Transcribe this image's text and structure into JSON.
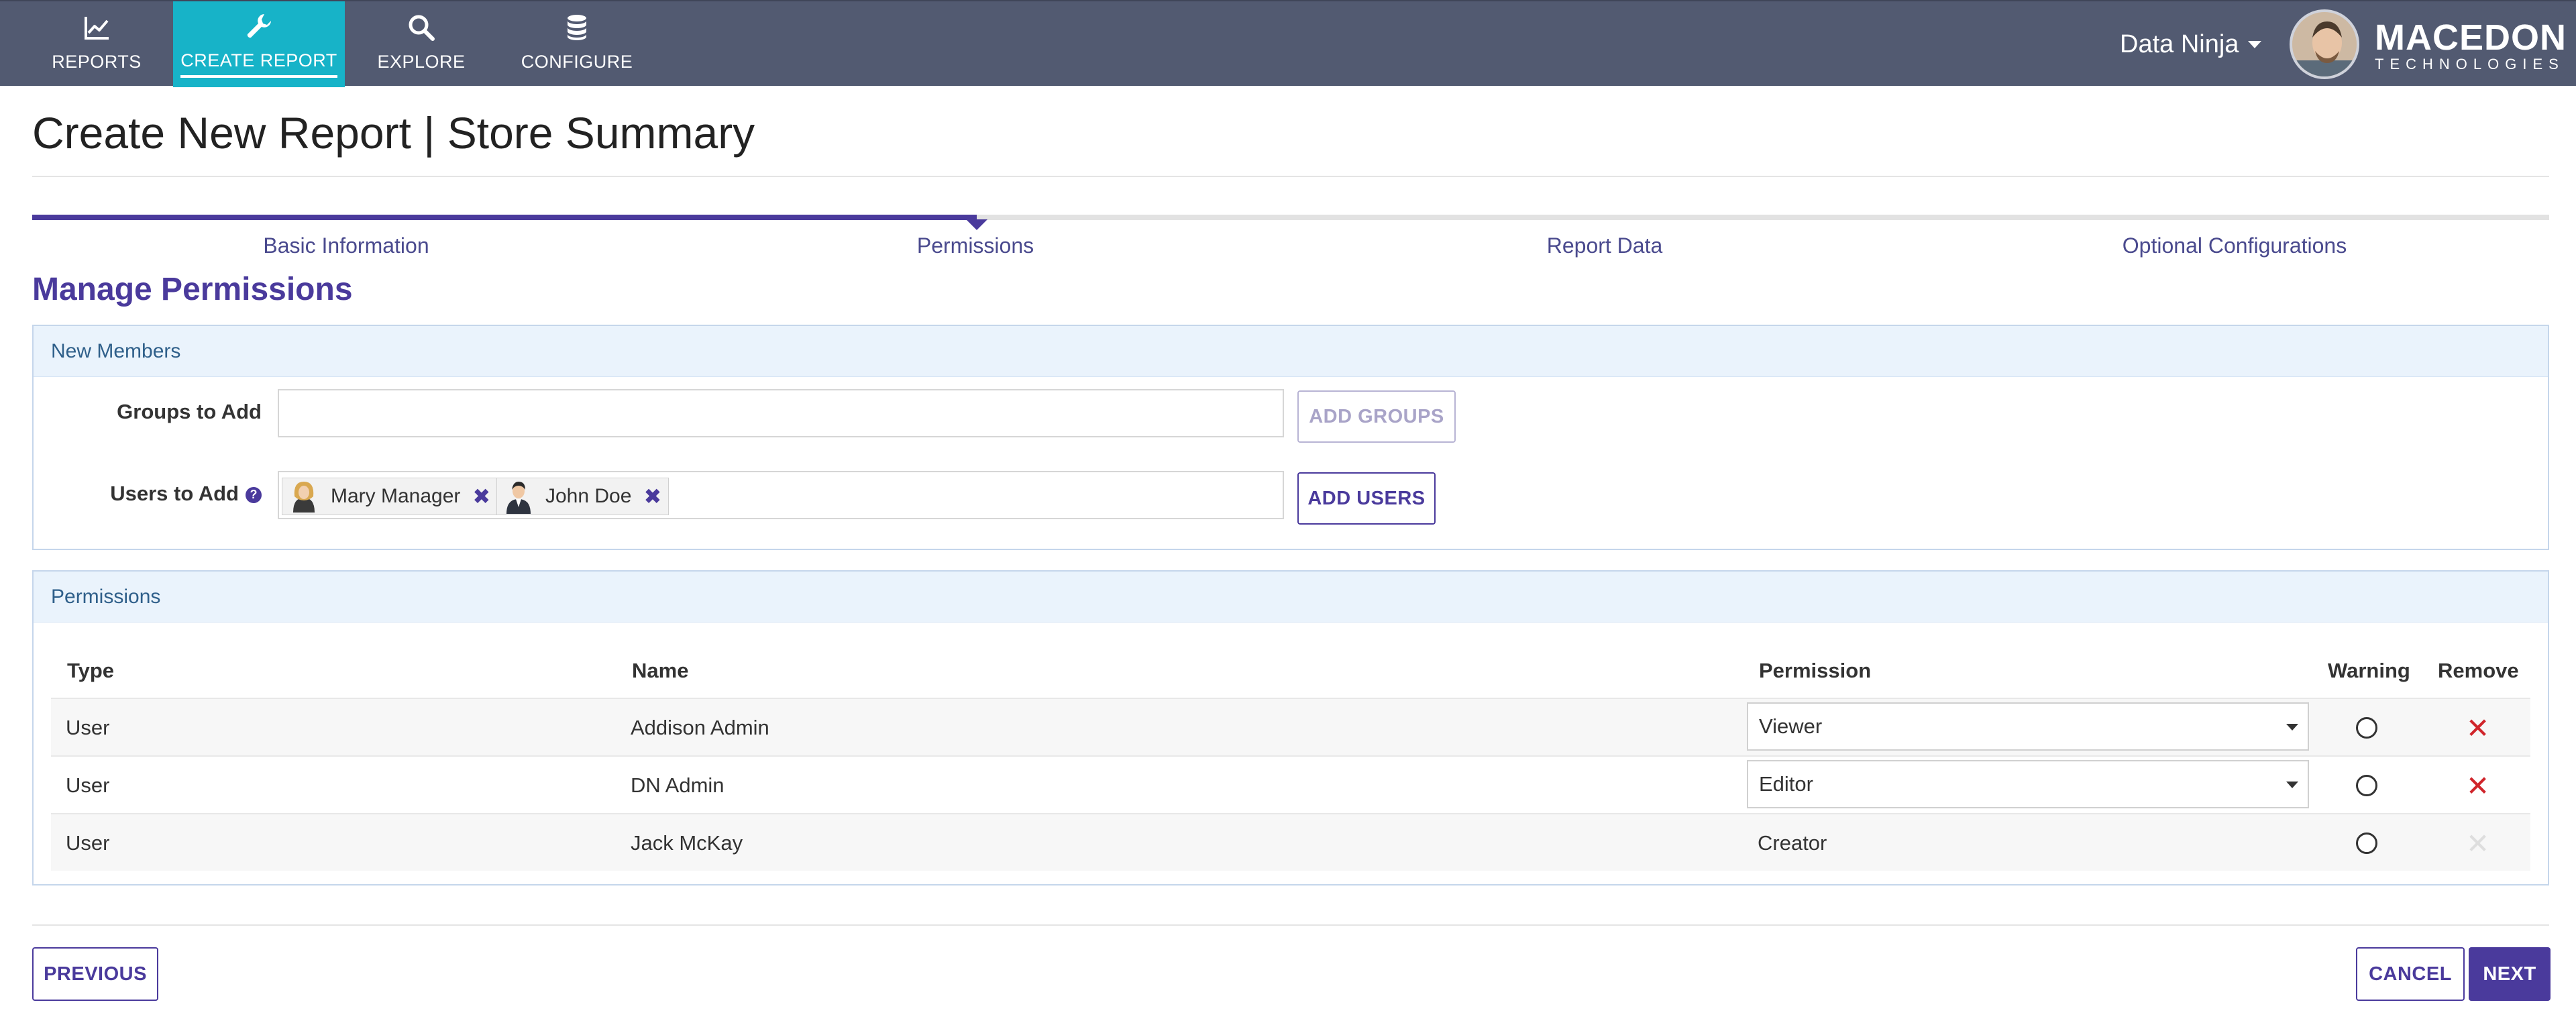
{
  "nav": {
    "items": [
      {
        "label": "REPORTS",
        "icon": "line-chart-icon"
      },
      {
        "label": "CREATE REPORT",
        "icon": "wrench-icon"
      },
      {
        "label": "EXPLORE",
        "icon": "search-icon"
      },
      {
        "label": "CONFIGURE",
        "icon": "database-icon"
      }
    ],
    "active": "CREATE REPORT",
    "active_color": "#17b3c8",
    "bar_color": "#525a71",
    "user_name": "Data Ninja",
    "brand_name": "MACEDON",
    "brand_tagline": "TECHNOLOGIES"
  },
  "page": {
    "title": "Create New Report | Store Summary",
    "section_heading": "Manage Permissions"
  },
  "stepper": {
    "steps": [
      "Basic Information",
      "Permissions",
      "Report Data",
      "Optional Configurations"
    ],
    "current": "Permissions",
    "accent_color": "#4a3a9c"
  },
  "new_members": {
    "header": "New Members",
    "groups_label": "Groups to Add",
    "groups_value": "",
    "add_groups_label": "ADD GROUPS",
    "users_label": "Users to Add",
    "users": [
      {
        "name": "Mary Manager",
        "remove": "✖"
      },
      {
        "name": "John Doe",
        "remove": "✖"
      }
    ],
    "add_users_label": "ADD USERS"
  },
  "permissions": {
    "header": "Permissions",
    "columns": [
      "Type",
      "Name",
      "Permission",
      "Warning",
      "Remove"
    ],
    "rows": [
      {
        "type": "User",
        "name": "Addison Admin",
        "permission": "Viewer",
        "editable": true,
        "removable": true
      },
      {
        "type": "User",
        "name": "DN Admin",
        "permission": "Editor",
        "editable": true,
        "removable": true
      },
      {
        "type": "User",
        "name": "Jack McKay",
        "permission": "Creator",
        "editable": false,
        "removable": false
      }
    ],
    "remove_glyph": "✕"
  },
  "footer": {
    "previous_label": "PREVIOUS",
    "cancel_label": "CANCEL",
    "next_label": "NEXT"
  }
}
